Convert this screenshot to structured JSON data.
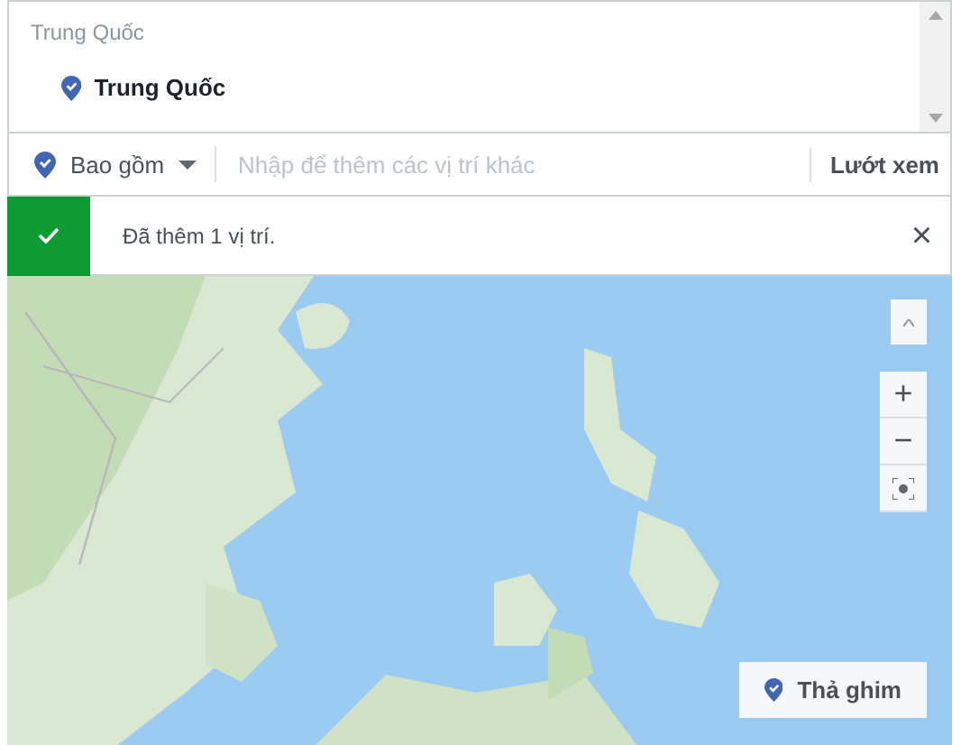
{
  "location_list": {
    "header": "Trung Quốc",
    "items": [
      {
        "label": "Trung Quốc"
      }
    ]
  },
  "filter": {
    "mode": "Bao gồm",
    "placeholder": "Nhập để thêm các vị trí khác",
    "browse": "Lướt xem"
  },
  "notice": {
    "text": "Đã thêm 1 vị trí.",
    "close": "×"
  },
  "map": {
    "kind": "picture",
    "zoom_in": "+",
    "zoom_out": "−",
    "drop_pin": "Thả ghim"
  }
}
